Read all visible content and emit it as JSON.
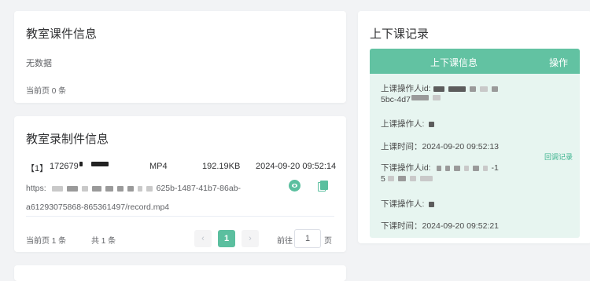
{
  "courseware": {
    "title": "教室课件信息",
    "empty_text": "无数据",
    "total_text": "当前页 0 条"
  },
  "recording": {
    "title": "教室录制件信息",
    "file": {
      "index": "【1】",
      "name_prefix": "172679",
      "format": "MP4",
      "size": "192.19KB",
      "time": "2024-09-20 09:52:14",
      "url_prefix": "https:",
      "url_mid": "625b-1487-41b7-86ab-",
      "url_line2": "a61293075868-865361497/record.mp4"
    },
    "pager": {
      "total_page": "当前页 1 条",
      "total_all": "共 1 条",
      "prev": "‹",
      "current": "1",
      "next": "›",
      "goto_label": "前往",
      "goto_value": "1",
      "page_label": "页"
    }
  },
  "class_records": {
    "title": "上下课记录",
    "header_info": "上下课信息",
    "header_action": "操作",
    "op_id_label": "上课操作人id:",
    "op_id_tail": "5bc-4d7",
    "op_name_label": "上课操作人:",
    "start_time": "上课时间：2024-09-20 09:52:13",
    "off_id_label": "下课操作人id:",
    "off_id_tail": "-1",
    "off_id_line2": "5",
    "off_name_label": "下课操作人:",
    "end_time": "下课时间：2024-09-20 09:52:21",
    "action_link": "回调记录"
  },
  "colors": {
    "accent": "#62c2a2",
    "row_bg": "#e7f5f0",
    "page_bg": "#f2f3f5"
  },
  "icons": {
    "preview": "eye-icon",
    "copy": "copy-icon"
  }
}
